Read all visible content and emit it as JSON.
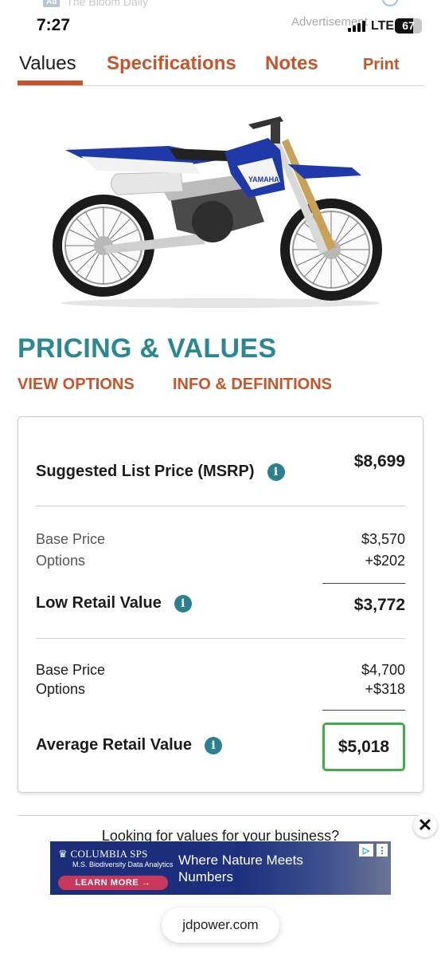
{
  "status_bar": {
    "time": "7:27",
    "network": "LTE",
    "battery": "67",
    "top_ad_chip": "Ad",
    "top_ad_text": "The Bloom Daily",
    "ad_label": "Advertisement"
  },
  "tabs": [
    {
      "label": "Values",
      "active": true
    },
    {
      "label": "Specifications",
      "active": false
    },
    {
      "label": "Notes",
      "active": false
    },
    {
      "label": "Print",
      "active": false
    }
  ],
  "pricing": {
    "title": "PRICING & VALUES",
    "view_options": "VIEW OPTIONS",
    "info_definitions": "INFO & DEFINITIONS",
    "msrp": {
      "label": "Suggested List Price (MSRP)",
      "value": "$8,699"
    },
    "low_retail": {
      "base_label": "Base Price",
      "base_value": "$3,570",
      "options_label": "Options",
      "options_value": "+$202",
      "label": "Low Retail Value",
      "value": "$3,772"
    },
    "average_retail": {
      "base_label": "Base Price",
      "base_value": "$4,700",
      "options_label": "Options",
      "options_value": "+$318",
      "label": "Average Retail Value",
      "value": "$5,018"
    }
  },
  "business_prompt": "Looking for values for your business?",
  "banner_ad": {
    "brand": "COLUMBIA SPS",
    "brand_sub": "M.S. Biodiversity Data Analytics",
    "cta": "LEARN MORE →",
    "headline": "Where Nature Meets Numbers"
  },
  "url": "jdpower.com",
  "colors": {
    "accent": "#c6552b",
    "teal": "#2c8890",
    "highlight": "#3fae4a"
  }
}
